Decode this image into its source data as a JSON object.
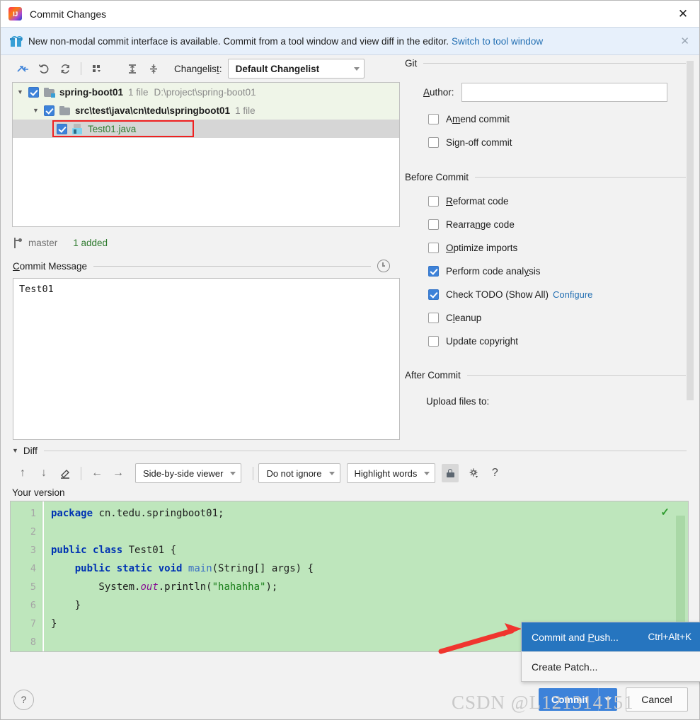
{
  "window": {
    "title": "Commit Changes",
    "app_icon": "intellij-idea-logo",
    "close_label": "✕"
  },
  "notification": {
    "icon": "gift-icon",
    "text": "New non-modal commit interface is available. Commit from a tool window and view diff in the editor.",
    "link": "Switch to tool window",
    "close_label": "✕"
  },
  "tree_toolbar": {
    "icons": [
      "show-diff-icon",
      "rollback-icon",
      "refresh-icon",
      "group-by-icon",
      "expand-all-icon",
      "collapse-all-icon"
    ],
    "changelist_label": "Changelist:",
    "changelist_value": "Default Changelist"
  },
  "tree": {
    "rows": [
      {
        "level": 1,
        "checked": true,
        "expanded": true,
        "icon": "folder-modified-icon",
        "name": "spring-boot01",
        "meta": "1 file",
        "path": "D:\\project\\spring-boot01",
        "selected": false
      },
      {
        "level": 2,
        "checked": true,
        "expanded": true,
        "icon": "folder-icon",
        "name": "src\\test\\java\\cn\\tedu\\springboot01",
        "meta": "1 file",
        "path": "",
        "selected": false
      },
      {
        "level": 3,
        "checked": true,
        "expanded": false,
        "icon": "java-file-icon",
        "name": "Test01.java",
        "meta": "",
        "path": "",
        "selected": true,
        "highlight_box": true
      }
    ]
  },
  "branch_bar": {
    "icon": "branch-icon",
    "branch": "master",
    "status": "1 added"
  },
  "commit_message": {
    "title": "Commit Message",
    "title_mnemonic": "C",
    "history_icon": "clock-icon",
    "value": "Test01"
  },
  "git_panel": {
    "group_title": "Git",
    "author_label": "Author:",
    "author_mnemonic": "A",
    "author_value": "",
    "checkboxes": [
      {
        "label": "Amend commit",
        "mnemonic": "m",
        "checked": false
      },
      {
        "label": "Sign-off commit",
        "mnemonic": "g",
        "checked": false
      }
    ]
  },
  "before_commit": {
    "group_title": "Before Commit",
    "checkboxes": [
      {
        "label": "Reformat code",
        "mnemonic": "R",
        "checked": false,
        "link": ""
      },
      {
        "label": "Rearrange code",
        "mnemonic": "n",
        "checked": false,
        "link": ""
      },
      {
        "label": "Optimize imports",
        "mnemonic": "O",
        "checked": false,
        "link": ""
      },
      {
        "label": "Perform code analysis",
        "mnemonic": "y",
        "checked": true,
        "link": ""
      },
      {
        "label": "Check TODO (Show All)",
        "mnemonic": "",
        "checked": true,
        "link": "Configure"
      },
      {
        "label": "Cleanup",
        "mnemonic": "l",
        "checked": false,
        "link": ""
      },
      {
        "label": "Update copyright",
        "mnemonic": "",
        "checked": false,
        "link": ""
      }
    ]
  },
  "after_commit": {
    "group_title": "After Commit",
    "upload_label": "Upload files to:"
  },
  "diff": {
    "section_label": "Diff",
    "toolbar": {
      "icons": [
        "previous-difference-icon",
        "next-difference-icon",
        "edit-source-icon",
        "accept-left-icon",
        "accept-right-icon"
      ],
      "viewer_mode": "Side-by-side viewer",
      "ignore_mode": "Do not ignore",
      "highlight_mode": "Highlight words",
      "lock_icon": "lock-icon",
      "settings_icon": "gear-icon",
      "help_icon": "question-mark-icon"
    },
    "pane_title": "Your version",
    "line_numbers": [
      "1",
      "2",
      "3",
      "4",
      "5",
      "6",
      "7",
      "8"
    ],
    "code_lines": [
      {
        "n": 1,
        "tokens": [
          {
            "t": "package",
            "c": "kw"
          },
          {
            "t": " cn.tedu.springboot01;",
            "c": "cls"
          }
        ]
      },
      {
        "n": 2,
        "tokens": []
      },
      {
        "n": 3,
        "tokens": [
          {
            "t": "public ",
            "c": "kw"
          },
          {
            "t": "class ",
            "c": "kw"
          },
          {
            "t": "Test01 {",
            "c": "cls"
          }
        ]
      },
      {
        "n": 4,
        "tokens": [
          {
            "t": "    ",
            "c": "cls"
          },
          {
            "t": "public ",
            "c": "kw"
          },
          {
            "t": "static ",
            "c": "kw"
          },
          {
            "t": "void ",
            "c": "kw"
          },
          {
            "t": "main",
            "c": "mth"
          },
          {
            "t": "(String[] args) {",
            "c": "cls"
          }
        ]
      },
      {
        "n": 5,
        "tokens": [
          {
            "t": "        System.",
            "c": "cls"
          },
          {
            "t": "out",
            "c": "fld"
          },
          {
            "t": ".println(",
            "c": "cls"
          },
          {
            "t": "\"hahahha\"",
            "c": "str"
          },
          {
            "t": ");",
            "c": "cls"
          }
        ]
      },
      {
        "n": 6,
        "tokens": [
          {
            "t": "    }",
            "c": "cls"
          }
        ]
      },
      {
        "n": 7,
        "tokens": [
          {
            "t": "}",
            "c": "cls"
          }
        ]
      },
      {
        "n": 8,
        "tokens": []
      }
    ],
    "status_icon": "green-check-icon"
  },
  "context_menu": {
    "items": [
      {
        "label": "Commit and Push...",
        "mnemonic": "P",
        "shortcut": "Ctrl+Alt+K",
        "selected": true
      },
      {
        "label": "Create Patch...",
        "mnemonic": "",
        "shortcut": "",
        "selected": false
      }
    ]
  },
  "bottom_bar": {
    "help_label": "?",
    "commit_label": "Commit",
    "cancel_label": "Cancel"
  },
  "annotation": {
    "arrow": "red-arrow",
    "watermark": "CSDN @L121314151"
  },
  "colors": {
    "accent_blue": "#3d82d9",
    "link_blue": "#2470b3",
    "diff_green": "#bee6bc",
    "selection_blue": "#2675bf",
    "tree_selected_gray": "#d6d6d6",
    "tree_row_green": "#eff5e8",
    "annotation_red": "#ef2020",
    "added_green": "#2e7a2e"
  }
}
